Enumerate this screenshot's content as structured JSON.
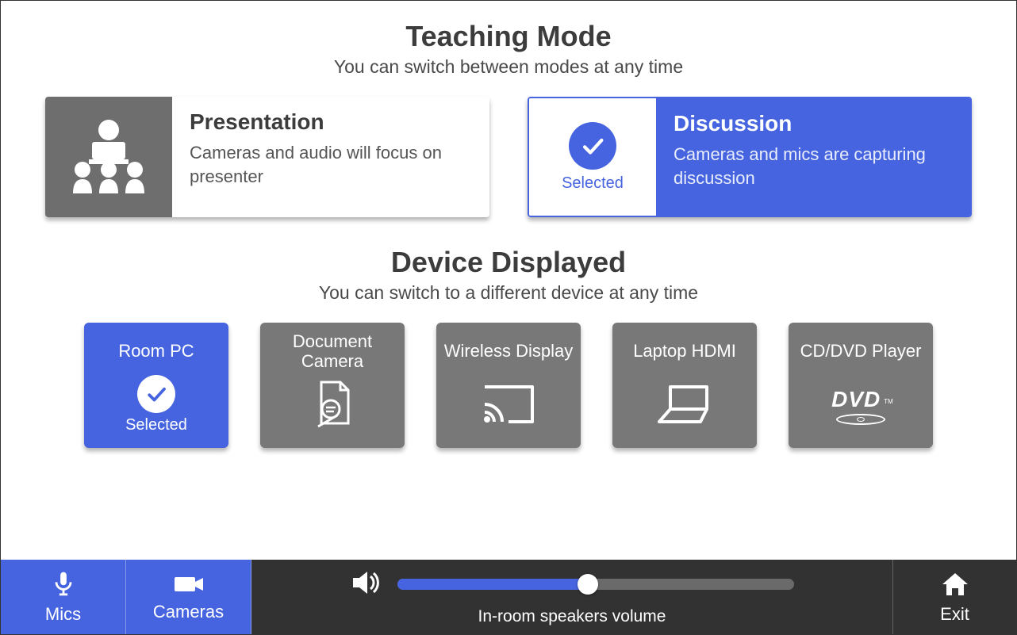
{
  "teaching": {
    "title": "Teaching Mode",
    "subtitle": "You can switch between modes at any time",
    "modes": [
      {
        "id": "presentation",
        "title": "Presentation",
        "description": "Cameras and audio will focus on presenter",
        "selected": false
      },
      {
        "id": "discussion",
        "title": "Discussion",
        "description": "Cameras and mics are capturing discussion",
        "selected": true,
        "selected_label": "Selected"
      }
    ]
  },
  "device": {
    "title": "Device Displayed",
    "subtitle": "You can switch to a different device at any time",
    "items": [
      {
        "label": "Room PC",
        "selected": true,
        "selected_label": "Selected"
      },
      {
        "label": "Document Camera",
        "selected": false
      },
      {
        "label": "Wireless Display",
        "selected": false
      },
      {
        "label": "Laptop HDMI",
        "selected": false
      },
      {
        "label": "CD/DVD Player",
        "selected": false
      }
    ]
  },
  "bottombar": {
    "mics": "Mics",
    "cameras": "Cameras",
    "volume_label": "In-room speakers volume",
    "volume_percent": 48,
    "exit": "Exit"
  }
}
